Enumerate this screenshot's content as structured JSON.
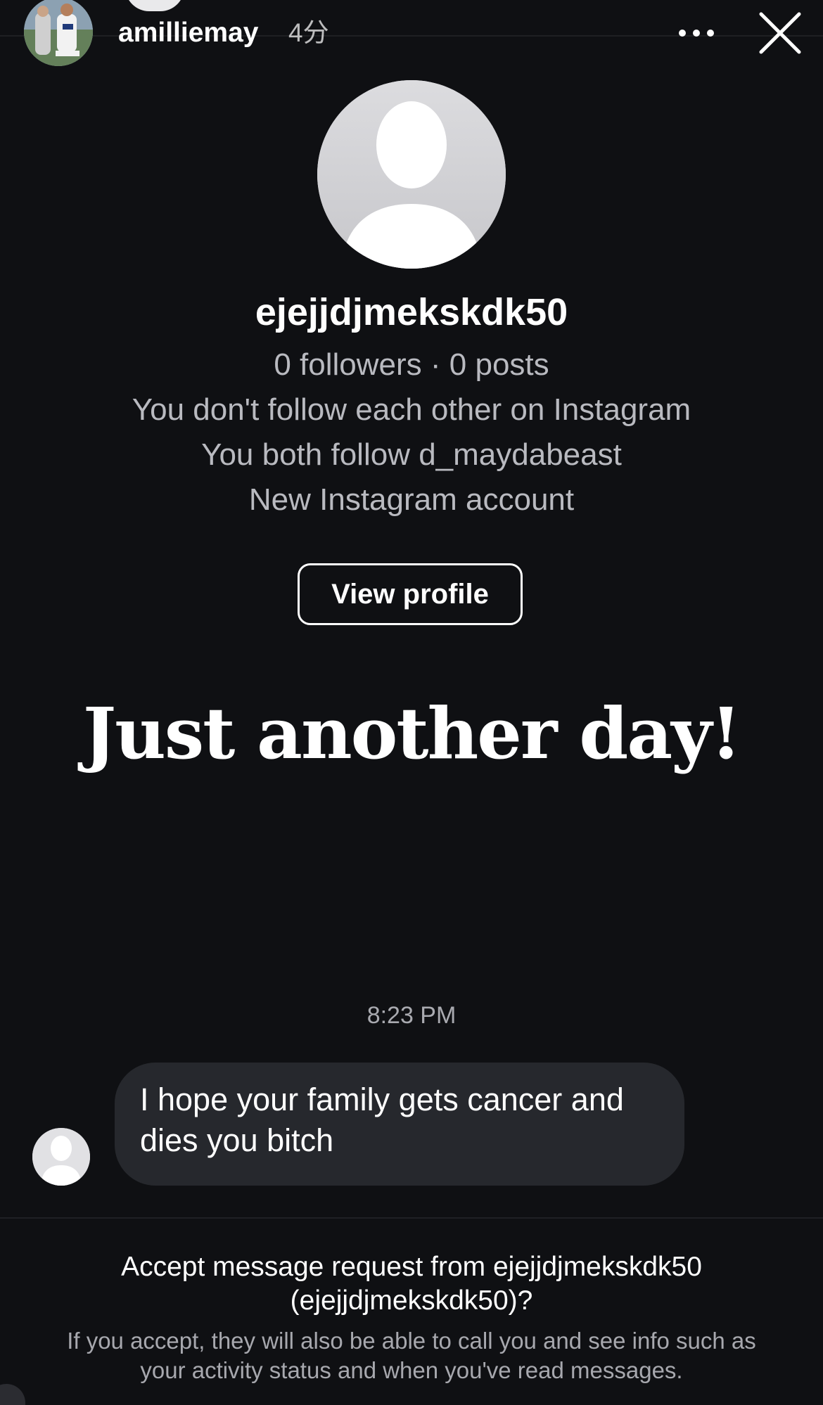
{
  "story_header": {
    "username": "amilliemay",
    "time": "4分",
    "avatar_icon": "photo-avatar-icon",
    "more_icon": "more-horizontal-icon",
    "close_icon": "close-icon"
  },
  "profile": {
    "photo_icon": "default-profile-icon",
    "username": "ejejjdjmekskdk50",
    "stats": "0 followers · 0 posts",
    "relationship": "You don't follow each other on Instagram",
    "mutual": "You both follow d_maydabeast",
    "account_status": "New Instagram account",
    "view_profile_label": "View profile"
  },
  "story_text": "Just another day!",
  "conversation": {
    "timestamp": "8:23 PM",
    "message": "I hope your family gets cancer and dies you bitch",
    "sender_avatar_icon": "default-avatar-icon"
  },
  "request": {
    "title": "Accept message request from ejejjdjmekskdk50 (ejejjdjmekskdk50)?",
    "note": "If you accept, they will also be able to call you and see info such as your activity status and when you've read messages."
  },
  "colors": {
    "background": "#0f1013",
    "bubble": "#26282d",
    "secondary_text": "#b9bac0",
    "primary_text": "#ffffff"
  }
}
